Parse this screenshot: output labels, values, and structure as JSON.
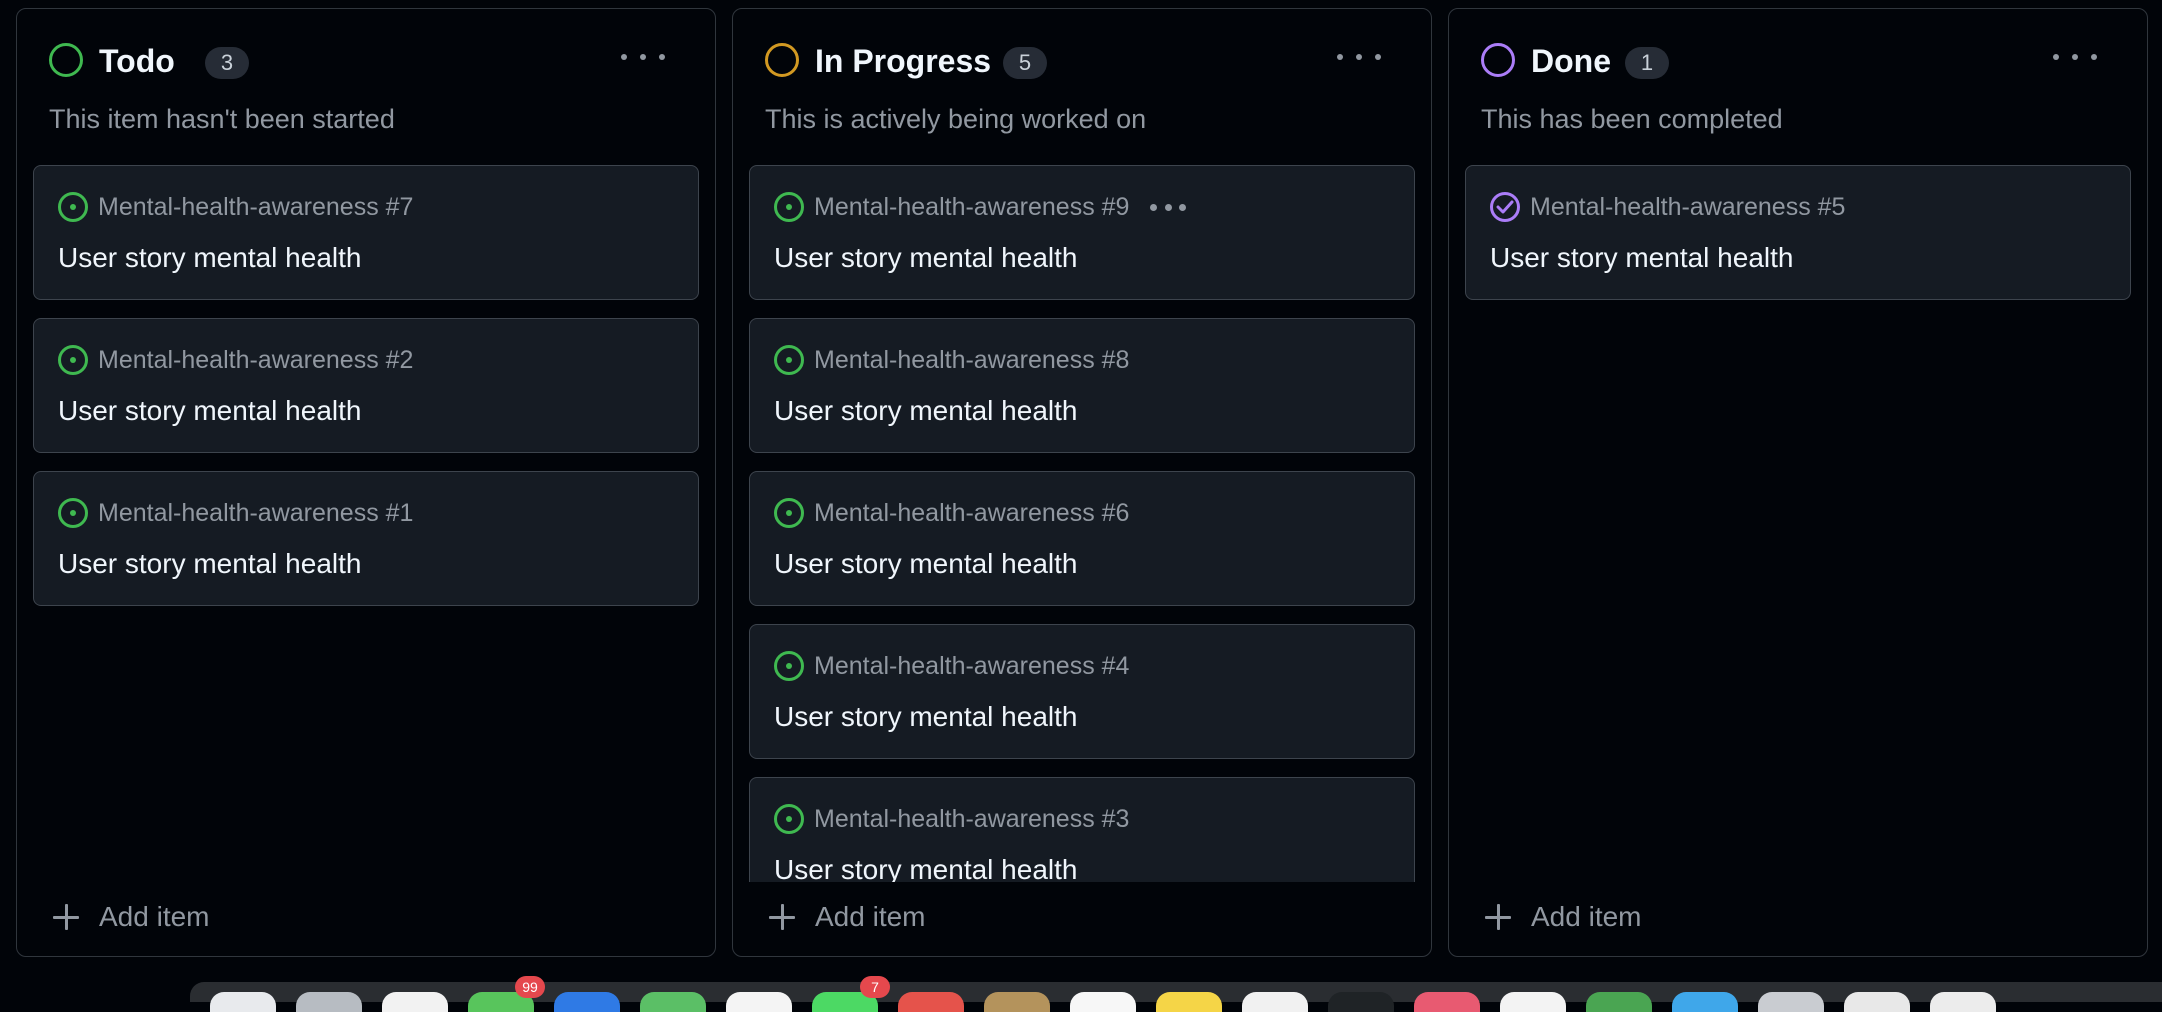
{
  "columns": [
    {
      "title": "Todo",
      "count": "3",
      "description": "This item hasn't been started",
      "status_color": "#3fb950",
      "add_label": "Add item",
      "cards": [
        {
          "ref": "Mental-health-awareness #7",
          "title": "User story mental health",
          "icon": "issue-open-icon"
        },
        {
          "ref": "Mental-health-awareness #2",
          "title": "User story mental health",
          "icon": "issue-open-icon"
        },
        {
          "ref": "Mental-health-awareness #1",
          "title": "User story mental health",
          "icon": "issue-open-icon"
        }
      ]
    },
    {
      "title": "In Progress",
      "count": "5",
      "description": "This is actively being worked on",
      "status_color": "#d29922",
      "add_label": "Add item",
      "cards": [
        {
          "ref": "Mental-health-awareness #9",
          "title": "User story mental health",
          "icon": "issue-open-icon"
        },
        {
          "ref": "Mental-health-awareness #8",
          "title": "User story mental health",
          "icon": "issue-open-icon"
        },
        {
          "ref": "Mental-health-awareness #6",
          "title": "User story mental health",
          "icon": "issue-open-icon"
        },
        {
          "ref": "Mental-health-awareness #4",
          "title": "User story mental health",
          "icon": "issue-open-icon"
        },
        {
          "ref": "Mental-health-awareness #3",
          "title": "User story mental health",
          "icon": "issue-open-icon"
        }
      ]
    },
    {
      "title": "Done",
      "count": "1",
      "description": "This has been completed",
      "status_color": "#ab7df8",
      "add_label": "Add item",
      "cards": [
        {
          "ref": "Mental-health-awareness #5",
          "title": "User story mental health",
          "icon": "issue-closed-icon"
        }
      ]
    }
  ],
  "colors": {
    "background": "#010409",
    "card": "#151b23",
    "border": "#30363d",
    "muted_text": "#9198a1",
    "open_issue": "#3fb950",
    "closed_issue": "#ab7df8"
  },
  "dock": {
    "badges": [
      "99",
      "7"
    ]
  }
}
